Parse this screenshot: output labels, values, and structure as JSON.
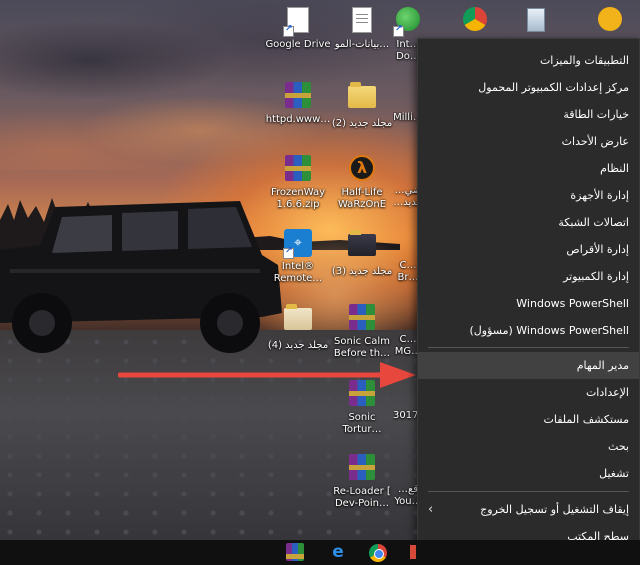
{
  "desktop": {
    "icons": [
      {
        "label": "Google Drive",
        "kind": "shortcut-white"
      },
      {
        "label": "بيانات-المو…",
        "kind": "doc"
      },
      {
        "label": "Int…\nDo…",
        "kind": "download-shortcut"
      },
      {
        "label": "",
        "kind": "chrome-shortcut"
      },
      {
        "label": "",
        "kind": "recycle-bin"
      },
      {
        "label": "",
        "kind": "yellow-shortcut"
      },
      {
        "label": "httpd.www…",
        "kind": "rar"
      },
      {
        "label": "(2) مجلد جديد",
        "kind": "folder"
      },
      {
        "label": "Milli…",
        "kind": "partial"
      },
      {
        "label": "FrozenWay\n1.6.6.zip",
        "kind": "rar"
      },
      {
        "label": "Half-Life\nWaRzOnE",
        "kind": "halflife"
      },
      {
        "label": "…ضي\n…جديد",
        "kind": "partial"
      },
      {
        "label": "Intel®\nRemote…",
        "kind": "intel"
      },
      {
        "label": "(3) مجلد جديد",
        "kind": "folder"
      },
      {
        "label": "C…\nBr…",
        "kind": "partial"
      },
      {
        "label": "(4) مجلد جديد",
        "kind": "folder"
      },
      {
        "label": "Sonic Calm\nBefore th…",
        "kind": "rar"
      },
      {
        "label": "C…\nMG…",
        "kind": "partial"
      },
      {
        "label": "Sonic\nTortur…",
        "kind": "rar"
      },
      {
        "label": "3017…",
        "kind": "partial"
      },
      {
        "label": "Re-Loader [\nDev-Poin…",
        "kind": "rar"
      },
      {
        "label": "…قع\nYou…",
        "kind": "partial"
      }
    ]
  },
  "context_menu": {
    "items": [
      {
        "label": "التطبيقات والميزات"
      },
      {
        "label": "مركز إعدادات الكمبيوتر المحمول"
      },
      {
        "label": "خيارات الطاقة"
      },
      {
        "label": "عارض الأحداث"
      },
      {
        "label": "النظام"
      },
      {
        "label": "إدارة الأجهزة"
      },
      {
        "label": "اتصالات الشبكة"
      },
      {
        "label": "إدارة الأقراص"
      },
      {
        "label": "إدارة الكمبيوتر"
      },
      {
        "label": "Windows PowerShell"
      },
      {
        "label": "Windows PowerShell (مسؤول)"
      },
      {
        "label": "مدير المهام",
        "highlighted": true
      },
      {
        "label": "الإعدادات"
      },
      {
        "label": "مستكشف الملفات"
      },
      {
        "label": "بحث"
      },
      {
        "label": "تشغيل"
      },
      {
        "label": "إيقاف التشغيل أو تسجيل الخروج",
        "has_submenu": true
      },
      {
        "label": "سطح المكتب"
      }
    ]
  },
  "annotation": {
    "arrow_color": "#e8473d",
    "points_to": "مدير المهام"
  },
  "taskbar": {
    "apps": [
      "winrar-icon",
      "edge-icon",
      "chrome-icon"
    ]
  },
  "colors": {
    "menu_bg": "#2b2b2b",
    "menu_hover": "#414141",
    "taskbar_bg": "#101010"
  }
}
